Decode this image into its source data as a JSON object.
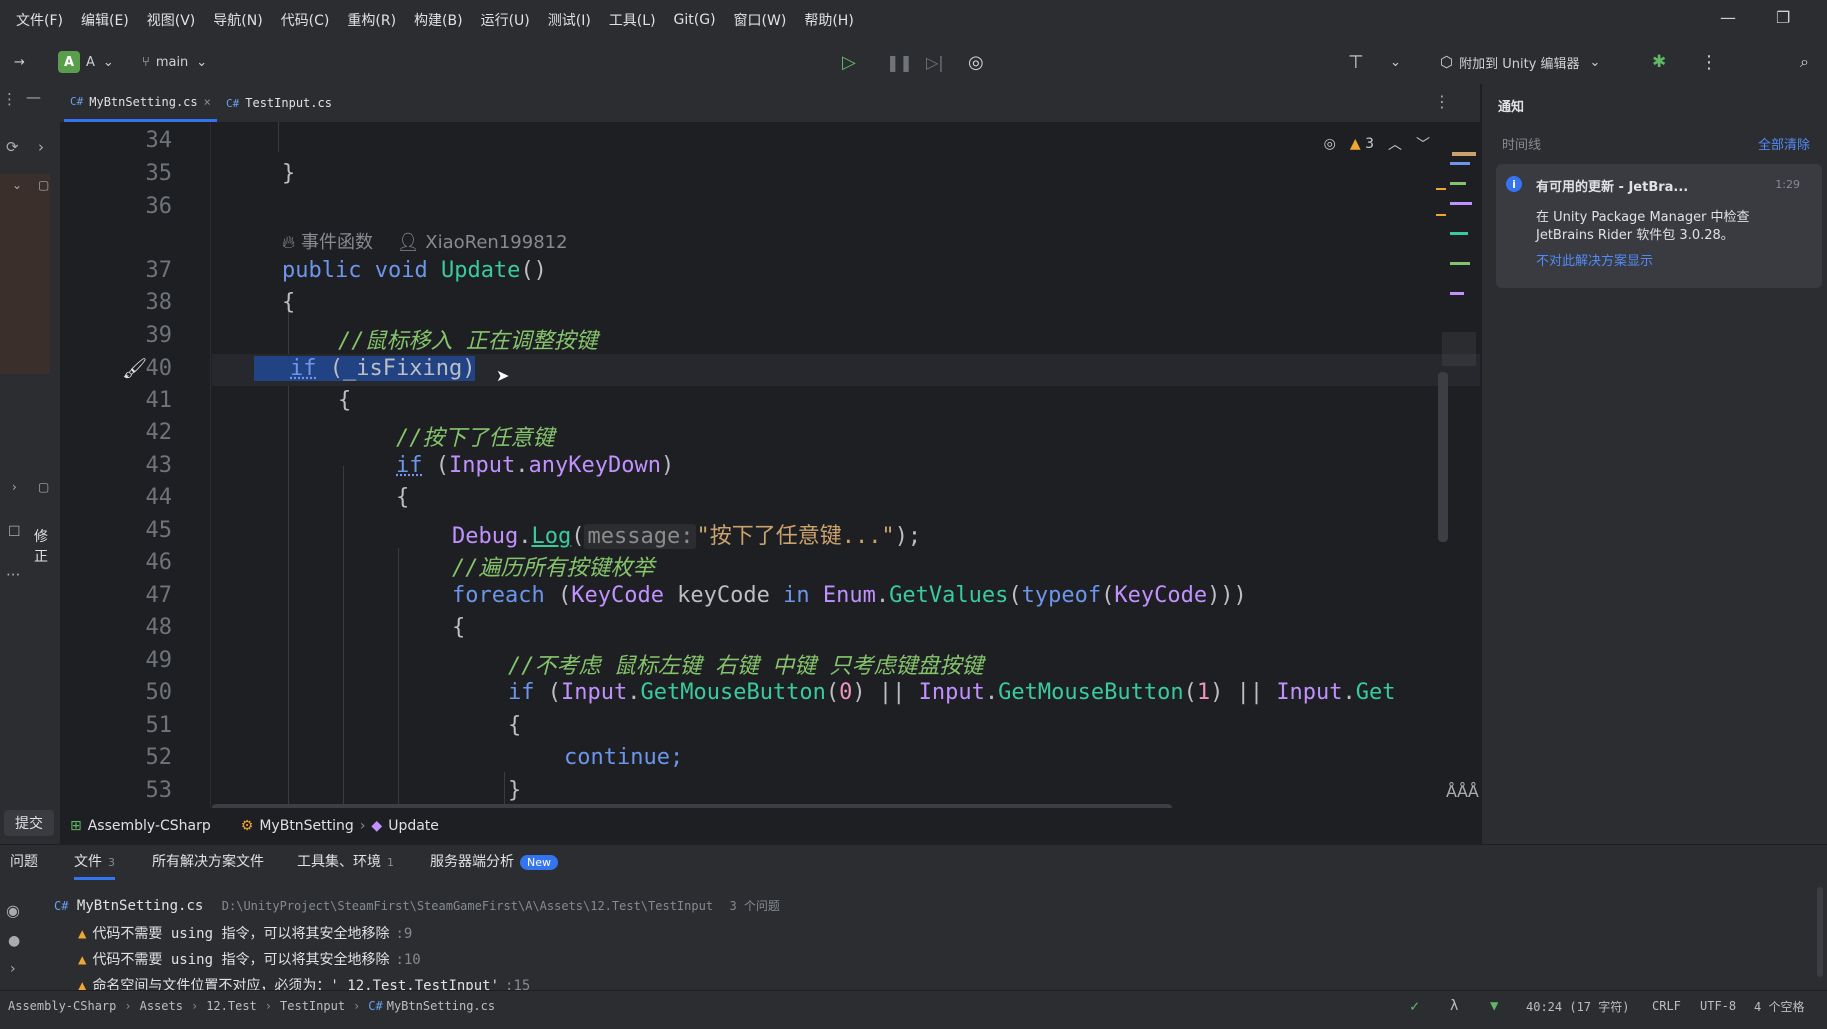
{
  "menu": [
    "文件(F)",
    "编辑(E)",
    "视图(V)",
    "导航(N)",
    "代码(C)",
    "重构(R)",
    "构建(B)",
    "运行(U)",
    "测试(I)",
    "工具(L)",
    "Git(G)",
    "窗口(W)",
    "帮助(H)"
  ],
  "toolbar": {
    "project_badge": "A",
    "project_name": "A",
    "branch": "main",
    "attach_label": "附加到 Unity 编辑器"
  },
  "tabs": [
    {
      "lang": "C#",
      "name": "MyBtnSetting.cs"
    },
    {
      "lang": "C#",
      "name": "TestInput.cs"
    }
  ],
  "editor": {
    "warning_count": "3",
    "codelens_event": "事件函数",
    "codelens_author": "XiaoRen199812",
    "line_numbers": [
      "34",
      "35",
      "36",
      "37",
      "38",
      "39",
      "40",
      "41",
      "42",
      "43",
      "44",
      "45",
      "46",
      "47",
      "48",
      "49",
      "50",
      "51",
      "52",
      "53"
    ],
    "lines": {
      "l35": "}",
      "l37_kw": "public void ",
      "l37_fn": "Update",
      "l37_rest": "()",
      "l38": "{",
      "l39": "//鼠标移入 正在调整按键",
      "l40_kw": "if",
      "l40_rest": " (_isFixing)",
      "l41": "{",
      "l42": "//按下了任意键",
      "l43_kw": "if",
      "l43_a": " (",
      "l43_ty": "Input",
      "l43_b": ".",
      "l43_fn": "anyKeyDown",
      "l43_c": ")",
      "l44": "{",
      "l45_ty": "Debug",
      "l45_a": ".",
      "l45_fn": "Log",
      "l45_b": "(",
      "l45_hint": "message:",
      "l45_str": "\"按下了任意键...\"",
      "l45_c": ");",
      "l46": "//遍历所有按键枚举",
      "l47_kw": "foreach",
      "l47_a": " (",
      "l47_ty": "KeyCode",
      "l47_b": " keyCode ",
      "l47_kw2": "in",
      "l47_c": " ",
      "l47_ty2": "Enum",
      "l47_d": ".",
      "l47_fn": "GetValues",
      "l47_e": "(",
      "l47_kw3": "typeof",
      "l47_f": "(",
      "l47_ty3": "KeyCode",
      "l47_g": ")))",
      "l48": "{",
      "l49": "//不考虑 鼠标左键 右键 中键 只考虑键盘按键",
      "l50_kw": "if",
      "l50_a": " (",
      "l50_ty": "Input",
      "l50_b": ".",
      "l50_fn": "GetMouseButton",
      "l50_c": "(",
      "l50_n0": "0",
      "l50_d": ") || ",
      "l50_ty2": "Input",
      "l50_e": ".",
      "l50_fn2": "GetMouseButton",
      "l50_f": "(",
      "l50_n1": "1",
      "l50_g": ") || ",
      "l50_ty3": "Input",
      "l50_h": ".",
      "l50_fn3": "Get",
      "l51": "{",
      "l52": "continue;",
      "l53": "}"
    }
  },
  "leftbar": {
    "commit_label": "提交",
    "fix_label": "修正"
  },
  "notifications": {
    "title": "通知",
    "timeline": "时间线",
    "clear_all": "全部清除",
    "card_title": "有可用的更新 - JetBra...",
    "card_time": "1:29",
    "card_body_1": "在 Unity Package Manager 中检查",
    "card_body_2": "JetBrains Rider 软件包 3.0.28。",
    "card_link": "不对此解决方案显示"
  },
  "breadcrumb": [
    "Assembly-CSharp",
    "MyBtnSetting",
    "Update"
  ],
  "problems": {
    "tabs": [
      {
        "label": "问题",
        "count": ""
      },
      {
        "label": "文件",
        "count": "3"
      },
      {
        "label": "所有解决方案文件",
        "count": ""
      },
      {
        "label": "工具集、环境",
        "count": "1"
      },
      {
        "label": "服务器端分析",
        "count": ""
      }
    ],
    "new_badge": "New",
    "file_lang": "C#",
    "file_name": "MyBtnSetting.cs",
    "file_path": "D:\\UnityProject\\SteamFirst\\SteamGameFirst\\A\\Assets\\12.Test\\TestInput",
    "file_count": "3 个问题",
    "items": [
      {
        "text": "代码不需要 using 指令，可以将其安全地移除",
        "loc": ":9"
      },
      {
        "text": "代码不需要 using 指令，可以将其安全地移除",
        "loc": ":10"
      },
      {
        "text": "命名空间与文件位置不对应，必须为：' 12.Test.TestInput'",
        "loc": ":15"
      }
    ]
  },
  "status": {
    "path": [
      "Assembly-CSharp",
      "Assets",
      "12.Test",
      "TestInput",
      "MyBtnSetting.cs"
    ],
    "path_lang": "C#",
    "position": "40:24 (17 字符)",
    "line_ending": "CRLF",
    "encoding": "UTF-8",
    "indent": "4 个空格"
  },
  "colors": {
    "accent": "#3574f0",
    "keyword": "#6c95eb",
    "method": "#39cc9b",
    "type": "#c191ff",
    "comment": "#85c46c",
    "string": "#c9a26d",
    "warning": "#f0a732"
  }
}
